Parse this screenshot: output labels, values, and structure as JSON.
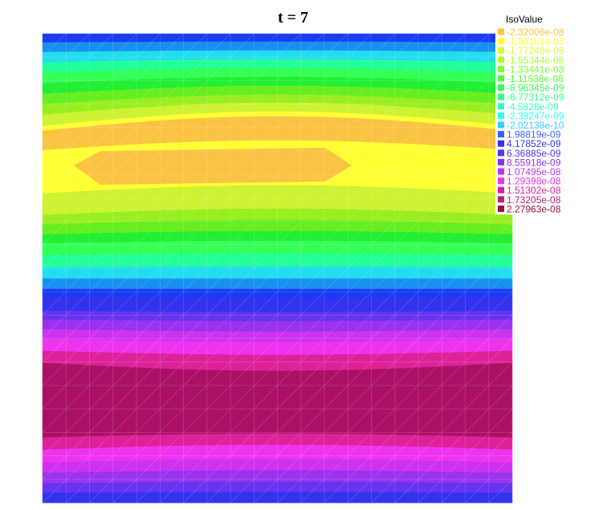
{
  "chart_data": {
    "type": "heatmap",
    "title": "t = 7",
    "legend": {
      "title": "IsoValue",
      "placement": "top-right",
      "entries": [
        {
          "label": "-2.32006e-08",
          "value": -2.32006e-08,
          "color": "#fbc344"
        },
        {
          "label": "-1.99151e-08",
          "value": -1.99151e-08,
          "color": "#ffff33"
        },
        {
          "label": "-1.77248e-08",
          "value": -1.77248e-08,
          "color": "#d4ff33"
        },
        {
          "label": "-1.55344e-08",
          "value": -1.55344e-08,
          "color": "#a8ff33"
        },
        {
          "label": "-1.33441e-08",
          "value": -1.33441e-08,
          "color": "#7dff33"
        },
        {
          "label": "-1.11538e-08",
          "value": -1.11538e-08,
          "color": "#52ff33"
        },
        {
          "label": "-8.96345e-09",
          "value": -8.96345e-09,
          "color": "#33ff55"
        },
        {
          "label": "-6.77312e-09",
          "value": -6.77312e-09,
          "color": "#33ff88"
        },
        {
          "label": "-4.5828e-09",
          "value": -4.5828e-09,
          "color": "#33ffbb"
        },
        {
          "label": "-2.39247e-09",
          "value": -2.39247e-09,
          "color": "#33ffee"
        },
        {
          "label": "-2.02138e-10",
          "value": -2.02138e-10,
          "color": "#33ccff"
        },
        {
          "label": "1.98819e-09",
          "value": 1.98819e-09,
          "color": "#3366ff"
        },
        {
          "label": "4.17852e-09",
          "value": 4.17852e-09,
          "color": "#3333ee"
        },
        {
          "label": "6.36885e-09",
          "value": 6.36885e-09,
          "color": "#5533ee"
        },
        {
          "label": "8.55918e-09",
          "value": 8.55918e-09,
          "color": "#8833ee"
        },
        {
          "label": "1.07495e-08",
          "value": 1.07495e-08,
          "color": "#bb33ee"
        },
        {
          "label": "1.29398e-08",
          "value": 1.29398e-08,
          "color": "#ee33ee"
        },
        {
          "label": "1.51302e-08",
          "value": 1.51302e-08,
          "color": "#dd2299"
        },
        {
          "label": "1.73205e-08",
          "value": 1.73205e-08,
          "color": "#bb2277"
        },
        {
          "label": "2.27963e-08",
          "value": 2.27963e-08,
          "color": "#991144"
        }
      ]
    },
    "field_bands": [
      {
        "level": 11,
        "color": "#1a3bf2"
      },
      {
        "level": 10,
        "color": "#1a8ff2"
      },
      {
        "level": 9,
        "color": "#22ddee"
      },
      {
        "level": 8,
        "color": "#22ff99"
      },
      {
        "level": 7,
        "color": "#33ff55"
      },
      {
        "level": 6,
        "color": "#22ee33"
      },
      {
        "level": 5,
        "color": "#66ee22"
      },
      {
        "level": 4,
        "color": "#99ee22"
      },
      {
        "level": 3,
        "color": "#ccf233"
      },
      {
        "level": 2,
        "color": "#ffff33"
      },
      {
        "level": 1,
        "color": "#fbc344"
      },
      {
        "level": 2,
        "color": "#ffff33"
      },
      {
        "level": 3,
        "color": "#ccf233"
      },
      {
        "level": 4,
        "color": "#99ee22"
      },
      {
        "level": 5,
        "color": "#66ee22"
      },
      {
        "level": 6,
        "color": "#22ee33"
      },
      {
        "level": 7,
        "color": "#33ff55"
      },
      {
        "level": 8,
        "color": "#22ff99"
      },
      {
        "level": 9,
        "color": "#22ddee"
      },
      {
        "level": 10,
        "color": "#1a8ff2"
      },
      {
        "level": 11,
        "color": "#1a3bf2"
      },
      {
        "level": 12,
        "color": "#3333ee"
      },
      {
        "level": 13,
        "color": "#6633ee"
      },
      {
        "level": 14,
        "color": "#9933ee"
      },
      {
        "level": 15,
        "color": "#cc33ee"
      },
      {
        "level": 16,
        "color": "#ee33ee"
      },
      {
        "level": 17,
        "color": "#dd2299"
      },
      {
        "level": 18,
        "color": "#aa1166"
      },
      {
        "level": 17,
        "color": "#dd2299"
      },
      {
        "level": 16,
        "color": "#ee33ee"
      },
      {
        "level": 15,
        "color": "#cc33ee"
      },
      {
        "level": 14,
        "color": "#9933ee"
      },
      {
        "level": 13,
        "color": "#6633ee"
      },
      {
        "level": 12,
        "color": "#3333ee"
      },
      {
        "level": 11,
        "color": "#1a3bf2"
      }
    ],
    "mesh_color": "#ffffff",
    "grid": true
  }
}
